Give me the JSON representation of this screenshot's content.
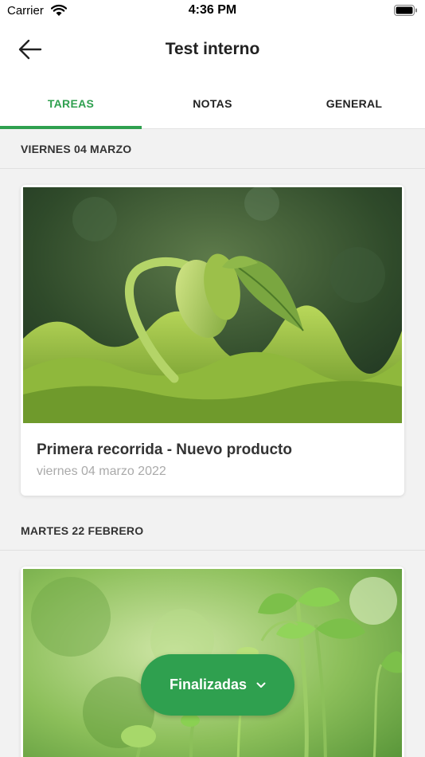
{
  "status_bar": {
    "carrier": "Carrier",
    "time": "4:36 PM"
  },
  "nav": {
    "title": "Test interno",
    "back_icon": "arrow-left-icon"
  },
  "tabs": [
    {
      "label": "TAREAS",
      "active": true
    },
    {
      "label": "NOTAS",
      "active": false
    },
    {
      "label": "GENERAL",
      "active": false
    }
  ],
  "sections": [
    {
      "header": "VIERNES 04 MARZO",
      "cards": [
        {
          "title": "Primera recorrida - Nuevo producto",
          "date": "viernes 04 marzo 2022",
          "image": "sprouting-seed-photo"
        }
      ]
    },
    {
      "header": "MARTES 22 FEBRERO",
      "cards": [
        {
          "image": "seedlings-photo"
        }
      ]
    }
  ],
  "filter_button": {
    "label": "Finalizadas",
    "icon": "chevron-down-icon"
  },
  "colors": {
    "accent": "#2fa04f",
    "background": "#f2f2f2"
  }
}
